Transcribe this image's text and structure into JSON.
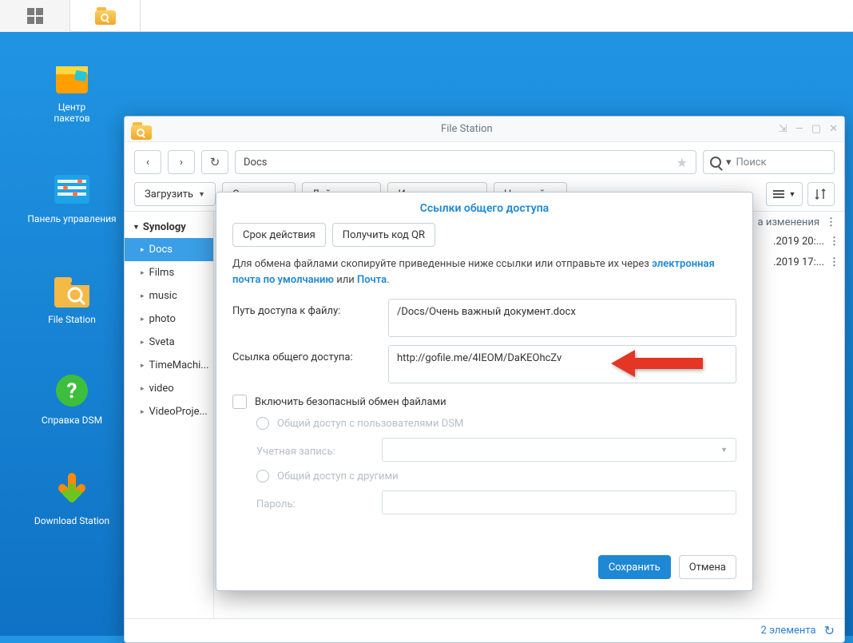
{
  "taskbar": {
    "items": [
      "apps",
      "file-station"
    ]
  },
  "desktop_icons": [
    {
      "label": "Центр\nпакетов"
    },
    {
      "label": "Панель управления"
    },
    {
      "label": "File Station"
    },
    {
      "label": "Справка DSM"
    },
    {
      "label": "Download Station"
    }
  ],
  "window": {
    "title": "File Station",
    "path": "Docs",
    "search_placeholder": "Поиск",
    "toolbar": {
      "upload": "Загрузить",
      "create": "Создать",
      "action": "Действие",
      "tools": "Инструменты",
      "settings": "Настройки"
    },
    "tree_root": "Synology",
    "tree": [
      "Docs",
      "Films",
      "music",
      "photo",
      "Sveta",
      "TimeMachi...",
      "video",
      "VideoProje..."
    ],
    "columns": {
      "modified": "а изменения"
    },
    "rows": [
      {
        "time": ".2019 20:..."
      },
      {
        "time": ".2019 17:..."
      }
    ],
    "status": {
      "count": "2 элемента"
    }
  },
  "dialog": {
    "title": "Ссылки общего доступа",
    "btn_expiry": "Срок действия",
    "btn_qr": "Получить код QR",
    "desc_pre": "Для обмена файлами скопируйте приведенные ниже ссылки или отправьте их через ",
    "desc_link1": "электронная почта по умолчанию",
    "desc_mid": " или ",
    "desc_link2": "Почта",
    "desc_post": ".",
    "path_label": "Путь доступа к файлу:",
    "path_value": "/Docs/Очень важный документ.docx",
    "share_label": "Ссылка общего доступа:",
    "share_value": "http://gofile.me/4IEOM/DaKEOhcZv",
    "enable_secure": "Включить безопасный обмен файлами",
    "share_dsm": "Общий доступ с пользователями DSM",
    "account": "Учетная запись:",
    "share_others": "Общий доступ с другими",
    "password": "Пароль:",
    "save": "Сохранить",
    "cancel": "Отмена"
  }
}
